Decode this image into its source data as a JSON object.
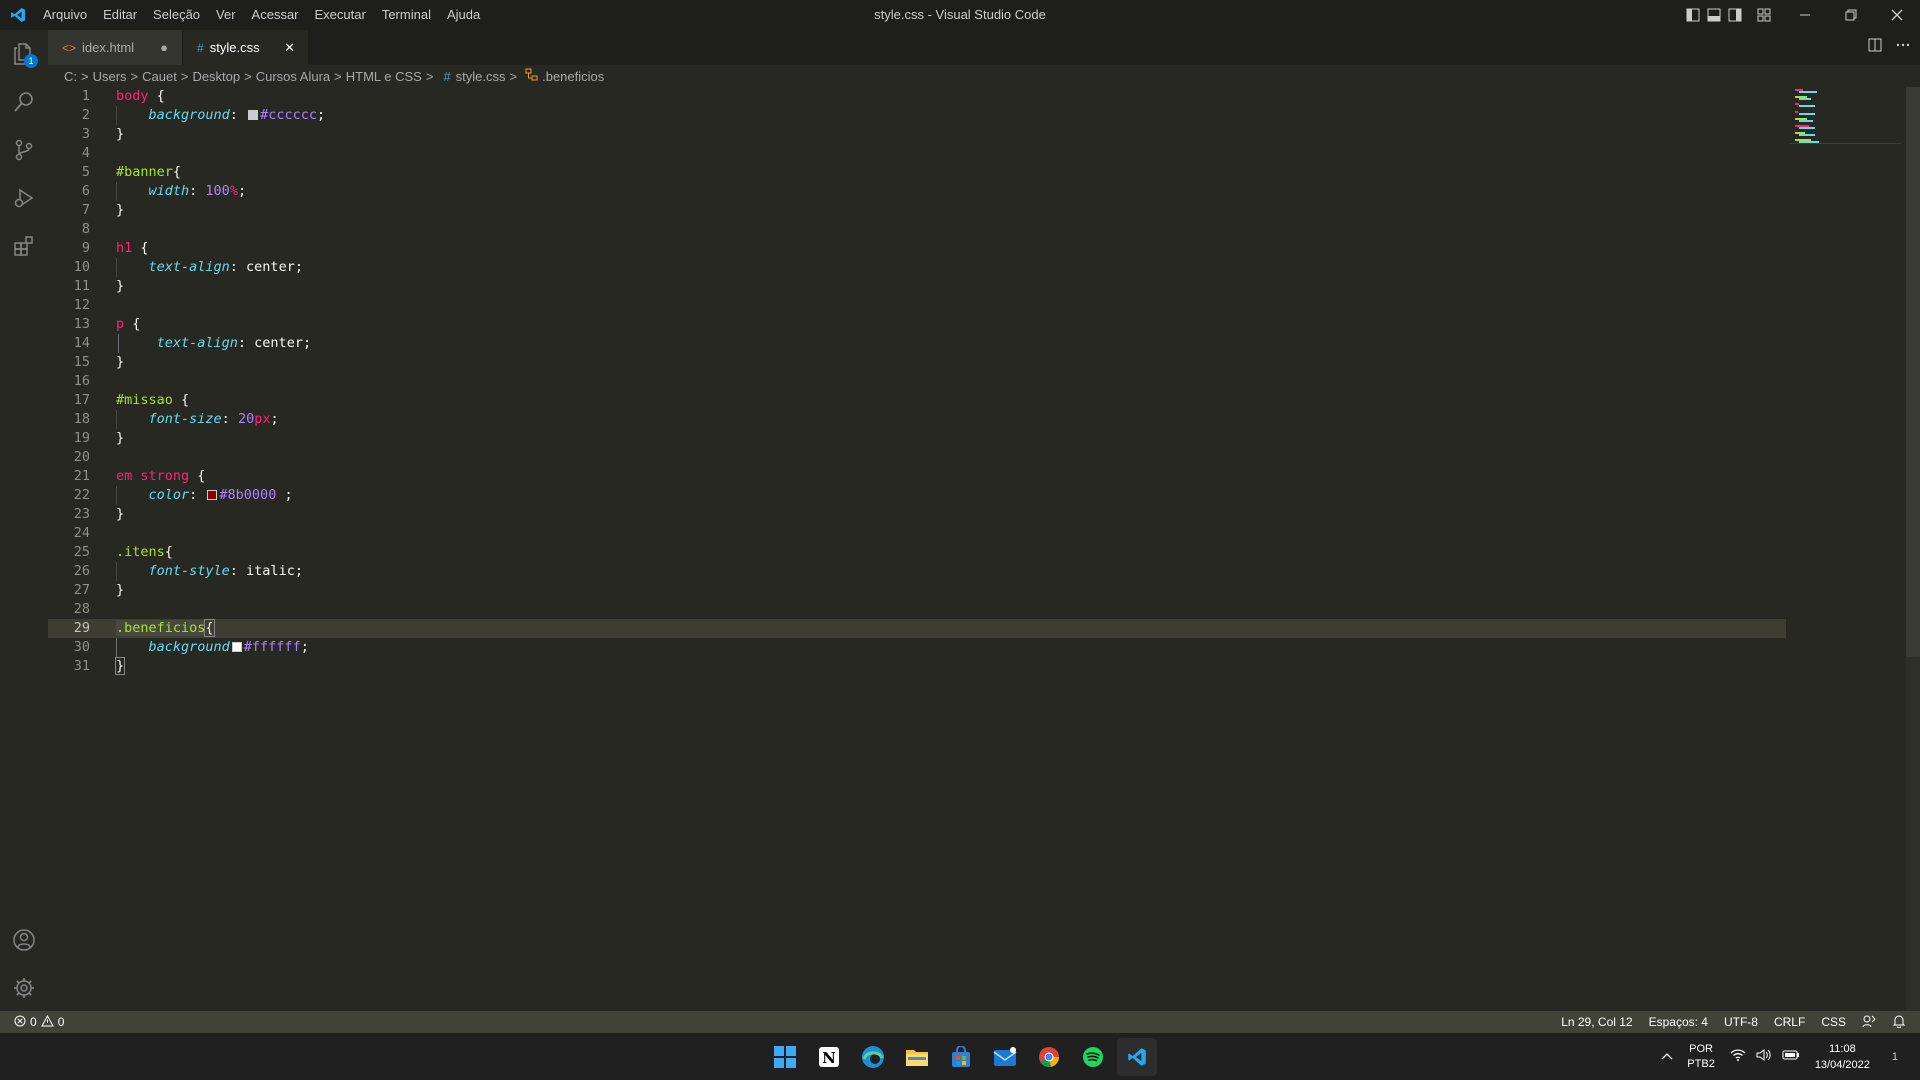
{
  "window": {
    "title": "style.css - Visual Studio Code"
  },
  "menu": [
    "Arquivo",
    "Editar",
    "Seleção",
    "Ver",
    "Acessar",
    "Executar",
    "Terminal",
    "Ajuda"
  ],
  "activity": {
    "explorer_badge": "1"
  },
  "tabs": [
    {
      "label": "idex.html",
      "icon": "html-file-icon",
      "modified_indicator": "●"
    },
    {
      "label": "style.css",
      "icon": "css-file-icon",
      "close": "✕"
    }
  ],
  "breadcrumb": [
    "C:",
    "Users",
    "Cauet",
    "Desktop",
    "Cursos Alura",
    "HTML e CSS",
    "style.css",
    ".beneficios"
  ],
  "editor": {
    "current_line": 29,
    "line_numbers": [
      "1",
      "2",
      "3",
      "4",
      "5",
      "6",
      "7",
      "8",
      "9",
      "10",
      "11",
      "12",
      "13",
      "14",
      "15",
      "16",
      "17",
      "18",
      "19",
      "20",
      "21",
      "22",
      "23",
      "24",
      "25",
      "26",
      "27",
      "28",
      "29",
      "30",
      "31"
    ],
    "code": {
      "l1_sel": "body",
      "l1_rest": " {",
      "l2_prop": "background",
      "l2_colon": ": ",
      "l2_val": "#cccccc",
      "l2_end": ";",
      "l3": "}",
      "l5_sel": "#banner",
      "l5_rest": "{",
      "l6_prop": "width",
      "l6_colon": ": ",
      "l6_num": "100",
      "l6_unit": "%",
      "l6_end": ";",
      "l7": "}",
      "l9_sel": "h1",
      "l9_rest": " {",
      "l10_prop": "text-align",
      "l10_val": ": center;",
      "l11": "}",
      "l13_sel": "p",
      "l13_rest": " {",
      "l14_prop": "text-align",
      "l14_val": ": center;",
      "l15": "}",
      "l17_sel": "#missao",
      "l17_rest": " {",
      "l18_prop": "font-size",
      "l18_colon": ": ",
      "l18_num": "20",
      "l18_unit": "px",
      "l18_end": ";",
      "l19": "}",
      "l21_sel": "em strong",
      "l21_rest": " {",
      "l22_prop": "color",
      "l22_colon": ": ",
      "l22_val": "#8b0000",
      "l22_end": " ;",
      "l23": "}",
      "l25_sel": ".itens",
      "l25_rest": "{",
      "l26_prop": "font-style",
      "l26_val": ": italic;",
      "l27": "}",
      "l29_sel": ".beneficios",
      "l29_rest": "{",
      "l30_prop": "background",
      "l30_colon": ":",
      "l30_val": "#ffffff",
      "l30_end": ";",
      "l31": "}"
    },
    "swatch_colors": {
      "l2": "#cccccc",
      "l22": "#8b0000",
      "l30": "#ffffff"
    }
  },
  "statusbar": {
    "errors": "0",
    "warnings": "0",
    "position": "Ln 29, Col 12",
    "spaces": "Espaços: 4",
    "encoding": "UTF-8",
    "eol": "CRLF",
    "language": "CSS"
  },
  "taskbar": {
    "lang_top": "POR",
    "lang_bottom": "PTB2",
    "time": "11:08",
    "date": "13/04/2022",
    "notification_count": "1"
  },
  "colors": {
    "accent": "#0078d4",
    "selector": "#f92672",
    "id": "#a6e22e",
    "property": "#66d9ef",
    "number": "#ae81ff"
  }
}
